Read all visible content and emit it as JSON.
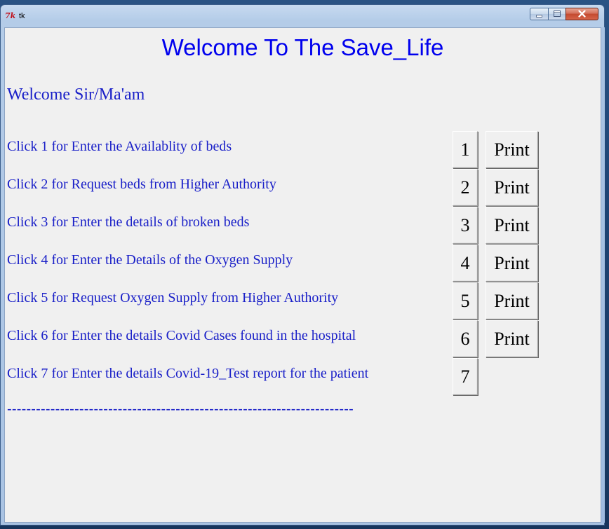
{
  "window": {
    "title": "tk",
    "icon": "tk-feather-icon",
    "controls": {
      "minimize": "minimize-icon",
      "maximize": "maximize-icon",
      "close": "close-icon"
    }
  },
  "main": {
    "heading": "Welcome To The Save_Life",
    "greeting": "Welcome Sir/Ma'am",
    "rows": [
      {
        "label": "Click 1 for Enter the Availablity of beds",
        "number": "1",
        "print": "Print"
      },
      {
        "label": "Click 2 for Request beds from Higher Authority",
        "number": "2",
        "print": "Print"
      },
      {
        "label": "Click 3 for Enter the details of broken beds",
        "number": "3",
        "print": "Print"
      },
      {
        "label": "Click 4 for Enter the Details of the Oxygen Supply",
        "number": "4",
        "print": "Print"
      },
      {
        "label": "Click 5 for Request Oxygen Supply from Higher Authority",
        "number": "5",
        "print": "Print"
      },
      {
        "label": "Click 6 for Enter the details Covid Cases found in the hospital",
        "number": "6",
        "print": "Print"
      },
      {
        "label": "Click 7 for Enter the details Covid-19_Test report for the patient",
        "number": "7"
      }
    ],
    "divider": "------------------------------------------------------------------------"
  },
  "colors": {
    "heading": "#0000ee",
    "text": "#1a20c8",
    "background": "#f0f0f0"
  }
}
